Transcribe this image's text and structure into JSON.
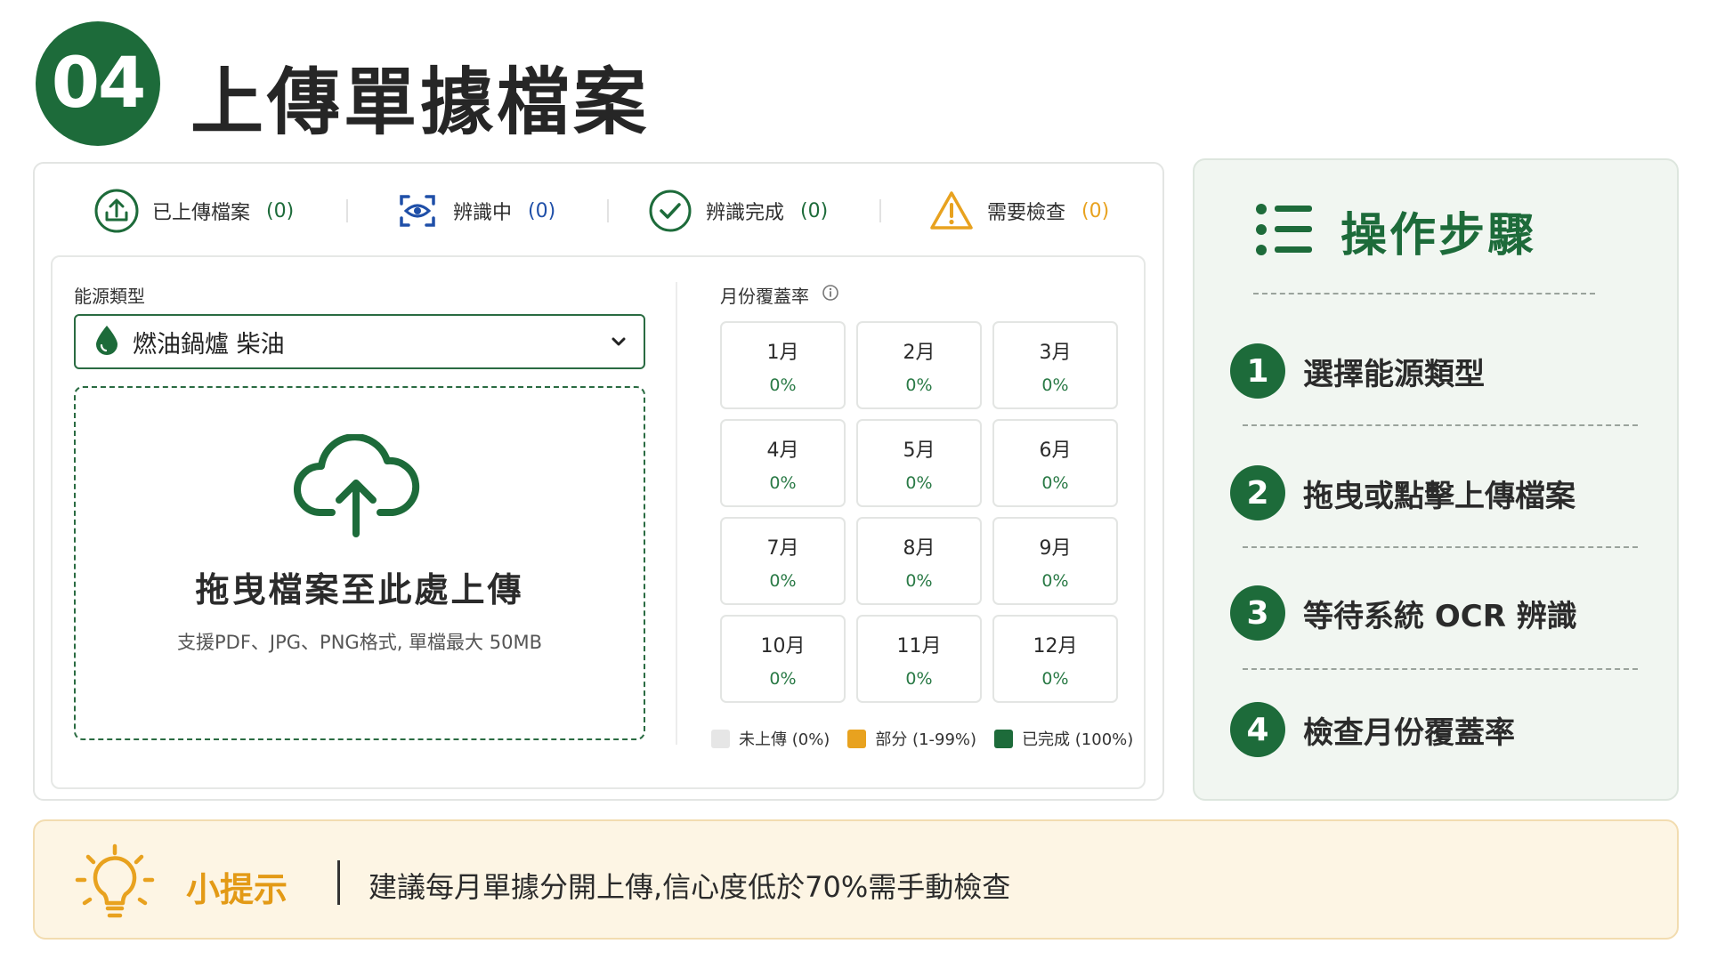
{
  "header": {
    "step_number": "04",
    "title": "上傳單據檔案"
  },
  "status": {
    "uploaded": {
      "label": "已上傳檔案",
      "count": "(0)"
    },
    "recognizing": {
      "label": "辨識中",
      "count": "(0)"
    },
    "done": {
      "label": "辨識完成",
      "count": "(0)"
    },
    "check": {
      "label": "需要檢查",
      "count": "(0)"
    }
  },
  "energy": {
    "label": "能源類型",
    "selected": "燃油鍋爐 柴油"
  },
  "dropzone": {
    "title": "拖曳檔案至此處上傳",
    "subtitle": "支援PDF、JPG、PNG格式, 單檔最大 50MB"
  },
  "coverage": {
    "label": "月份覆蓋率",
    "months": [
      {
        "name": "1月",
        "pct": "0%"
      },
      {
        "name": "2月",
        "pct": "0%"
      },
      {
        "name": "3月",
        "pct": "0%"
      },
      {
        "name": "4月",
        "pct": "0%"
      },
      {
        "name": "5月",
        "pct": "0%"
      },
      {
        "name": "6月",
        "pct": "0%"
      },
      {
        "name": "7月",
        "pct": "0%"
      },
      {
        "name": "8月",
        "pct": "0%"
      },
      {
        "name": "9月",
        "pct": "0%"
      },
      {
        "name": "10月",
        "pct": "0%"
      },
      {
        "name": "11月",
        "pct": "0%"
      },
      {
        "name": "12月",
        "pct": "0%"
      }
    ],
    "legend": [
      {
        "label": "未上傳 (0%)",
        "color": "#e6e6e6"
      },
      {
        "label": "部分 (1-99%)",
        "color": "#e8a21f"
      },
      {
        "label": "已完成 (100%)",
        "color": "#1d6b3a"
      }
    ]
  },
  "steps": {
    "title": "操作步驟",
    "items": [
      {
        "num": "1",
        "text": "選擇能源類型"
      },
      {
        "num": "2",
        "text": "拖曳或點擊上傳檔案"
      },
      {
        "num": "3",
        "text": "等待系統 OCR 辨識"
      },
      {
        "num": "4",
        "text": "檢查月份覆蓋率"
      }
    ]
  },
  "tip": {
    "label": "小提示",
    "text": "建議每月單據分開上傳,信心度低於70%需手動檢查"
  },
  "colors": {
    "brand_green": "#1d6b3a",
    "accent_orange": "#e8a21f",
    "info_blue": "#1f4fa8"
  }
}
